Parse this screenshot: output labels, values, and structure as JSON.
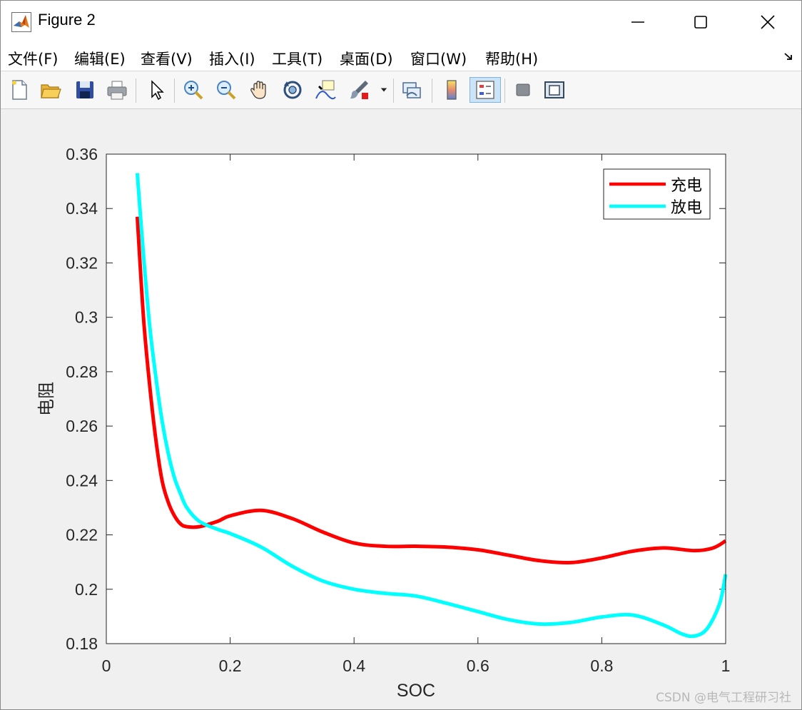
{
  "window": {
    "title": "Figure 2"
  },
  "menu": {
    "items": [
      {
        "label": "文件(F)"
      },
      {
        "label": "编辑(E)"
      },
      {
        "label": "查看(V)"
      },
      {
        "label": "插入(I)"
      },
      {
        "label": "工具(T)"
      },
      {
        "label": "桌面(D)"
      },
      {
        "label": "窗口(W)"
      },
      {
        "label": "帮助(H)"
      }
    ]
  },
  "toolbar": {
    "buttons": [
      "new-figure",
      "open-file",
      "save",
      "print",
      "select-arrow",
      "zoom-in",
      "zoom-out",
      "pan",
      "rotate-3d",
      "data-cursor",
      "brush",
      "link-plot",
      "colorbar",
      "legend",
      "hide-plot-tools",
      "show-plot-tools"
    ],
    "active": "legend"
  },
  "colors": {
    "series_charge": "#ff0000",
    "series_discharge": "#00ffff"
  },
  "chart_data": {
    "type": "line",
    "xlabel": "SOC",
    "ylabel": "电阻",
    "xlim": [
      0,
      1
    ],
    "ylim": [
      0.18,
      0.36
    ],
    "xticks": [
      "0",
      "0.2",
      "0.4",
      "0.6",
      "0.8",
      "1"
    ],
    "yticks": [
      "0.18",
      "0.2",
      "0.22",
      "0.24",
      "0.26",
      "0.28",
      "0.3",
      "0.32",
      "0.34",
      "0.36"
    ],
    "legend_position": "top-right",
    "grid": false,
    "series": [
      {
        "name": "充电",
        "color": "#ff0000",
        "x": [
          0.05,
          0.06,
          0.07,
          0.08,
          0.09,
          0.1,
          0.11,
          0.12,
          0.13,
          0.15,
          0.18,
          0.2,
          0.25,
          0.3,
          0.35,
          0.4,
          0.45,
          0.5,
          0.55,
          0.6,
          0.65,
          0.7,
          0.75,
          0.8,
          0.85,
          0.9,
          0.95,
          0.98,
          1.0
        ],
        "y": [
          0.337,
          0.3,
          0.275,
          0.255,
          0.24,
          0.232,
          0.227,
          0.224,
          0.223,
          0.223,
          0.225,
          0.227,
          0.229,
          0.226,
          0.221,
          0.217,
          0.2158,
          0.2158,
          0.2155,
          0.2145,
          0.2125,
          0.2105,
          0.2098,
          0.2115,
          0.214,
          0.2152,
          0.2142,
          0.2152,
          0.2178
        ]
      },
      {
        "name": "放电",
        "color": "#00ffff",
        "x": [
          0.05,
          0.06,
          0.07,
          0.08,
          0.09,
          0.1,
          0.11,
          0.12,
          0.13,
          0.15,
          0.18,
          0.2,
          0.25,
          0.3,
          0.35,
          0.4,
          0.45,
          0.5,
          0.55,
          0.6,
          0.65,
          0.7,
          0.75,
          0.8,
          0.85,
          0.9,
          0.93,
          0.95,
          0.97,
          0.99,
          1.0
        ],
        "y": [
          0.353,
          0.323,
          0.297,
          0.278,
          0.262,
          0.25,
          0.241,
          0.235,
          0.23,
          0.225,
          0.222,
          0.2205,
          0.2155,
          0.2085,
          0.203,
          0.2,
          0.1985,
          0.1975,
          0.1948,
          0.1918,
          0.1888,
          0.1872,
          0.1878,
          0.1898,
          0.1905,
          0.1868,
          0.1835,
          0.1828,
          0.1855,
          0.1945,
          0.2055
        ]
      }
    ]
  },
  "watermark": "CSDN @电气工程研习社"
}
